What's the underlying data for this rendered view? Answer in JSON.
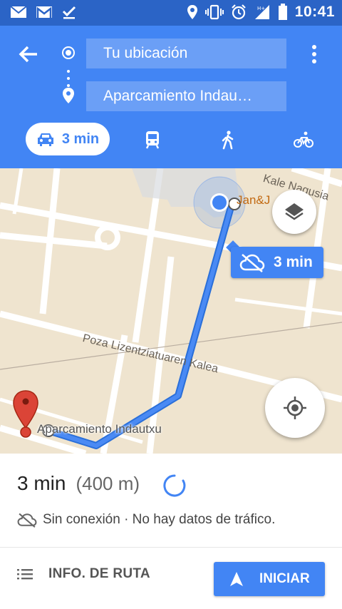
{
  "status_bar": {
    "time": "10:41",
    "icons": [
      "gmail-icon",
      "gmail-icon",
      "download-done-icon",
      "location-icon",
      "vibrate-icon",
      "alarm-icon",
      "signal-icon",
      "battery-icon"
    ]
  },
  "header": {
    "origin": "Tu ubicación",
    "destination": "Aparcamiento Indau…",
    "modes": [
      {
        "name": "car",
        "label": "3 min",
        "selected": true
      },
      {
        "name": "transit",
        "label": ""
      },
      {
        "name": "walk",
        "label": ""
      },
      {
        "name": "bike",
        "label": ""
      }
    ]
  },
  "map": {
    "street_1": "Kale Nagusia",
    "street_2": "Poza Lizentziatuaren Kalea",
    "poi": "Jan&J",
    "destination_label": "Aparcamiento Indautxu",
    "eta_badge": "3 min"
  },
  "bottom": {
    "time": "3 min",
    "distance": "(400 m)",
    "traffic_text": "Sin conexión · No hay datos de tráfico.",
    "info_button": "INFO. DE RUTA",
    "start_button": "INICIAR"
  },
  "colors": {
    "primary": "#4285f4",
    "status_bar": "#2b64c6",
    "map_bg": "#efe4cf",
    "route": "#4285f4",
    "pin": "#db4437"
  }
}
